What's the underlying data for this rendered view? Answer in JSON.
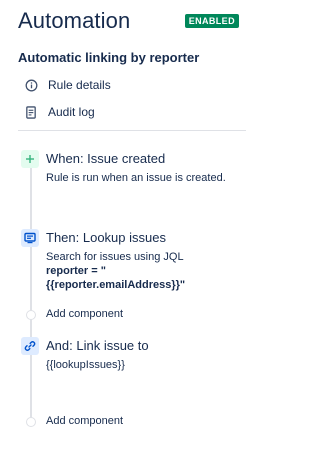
{
  "header": {
    "title": "Automation",
    "badge": "ENABLED"
  },
  "rule": {
    "name": "Automatic linking by reporter"
  },
  "menu": {
    "rule_details": "Rule details",
    "audit_log": "Audit log"
  },
  "steps": [
    {
      "title": "When: Issue created",
      "description": "Rule is run when an issue is created.",
      "icon": "plus-icon"
    },
    {
      "title": "Then: Lookup issues",
      "description": "Search for issues using JQL",
      "jql_line1": "reporter = \"",
      "jql_line2": "{{reporter.emailAddress}}\"",
      "icon": "lookup-icon"
    },
    {
      "title": "And: Link issue to",
      "description": "{{lookupIssues}}",
      "icon": "link-icon"
    }
  ],
  "add_component_label": "Add component",
  "colors": {
    "badge_bg": "#00875A",
    "trigger_bg": "#E3FCEF",
    "trigger_fg": "#36B37E",
    "action_bg": "#DEEBFF",
    "action_fg": "#0052CC"
  }
}
